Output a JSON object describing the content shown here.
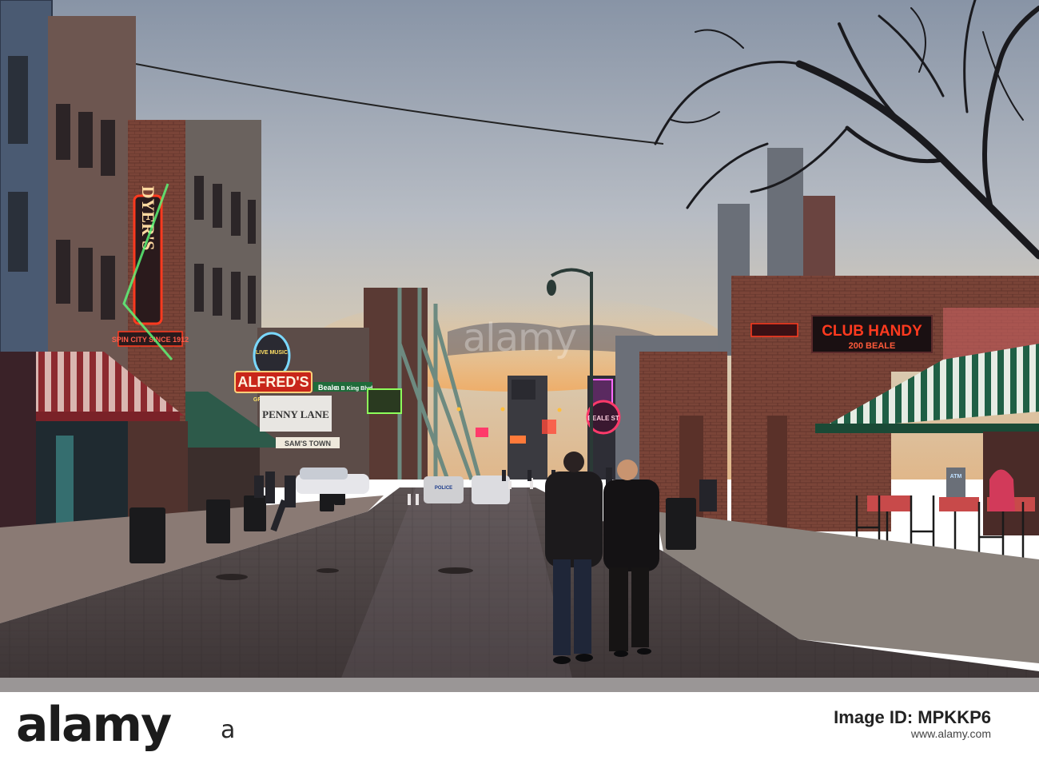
{
  "scene": {
    "signs": {
      "dyers": "DYER'S",
      "dyers_sub": "SPIN CITY SINCE 1912",
      "alfreds": "ALFRED'S",
      "alfreds_top": "LIVE MUSIC",
      "alfreds_sub": "GREAT FOOD",
      "beale": "Beale",
      "bbking": "B B King Blvd",
      "penny_lane": "PENNY LANE",
      "sams_town": "SAM'S TOWN",
      "beale_st": "BEALE ST",
      "club_handy": "CLUB HANDY",
      "club_handy_sub": "200 BEALE",
      "police": "POLICE",
      "atm": "ATM"
    }
  },
  "watermark": {
    "center": "alamy",
    "footer_brand": "alamy",
    "footer_mark": "a",
    "image_id": "Image ID: MPKKP6",
    "site": "www.alamy.com"
  },
  "colors": {
    "sky_top": "#8a98a8",
    "sky_horizon": "#d9c6a6",
    "neon_red": "#ff3a1f",
    "neon_green": "#5cff7a",
    "awning_green": "#1f5f45",
    "awning_red": "#8c2a2f",
    "brick": "#7a4438"
  }
}
